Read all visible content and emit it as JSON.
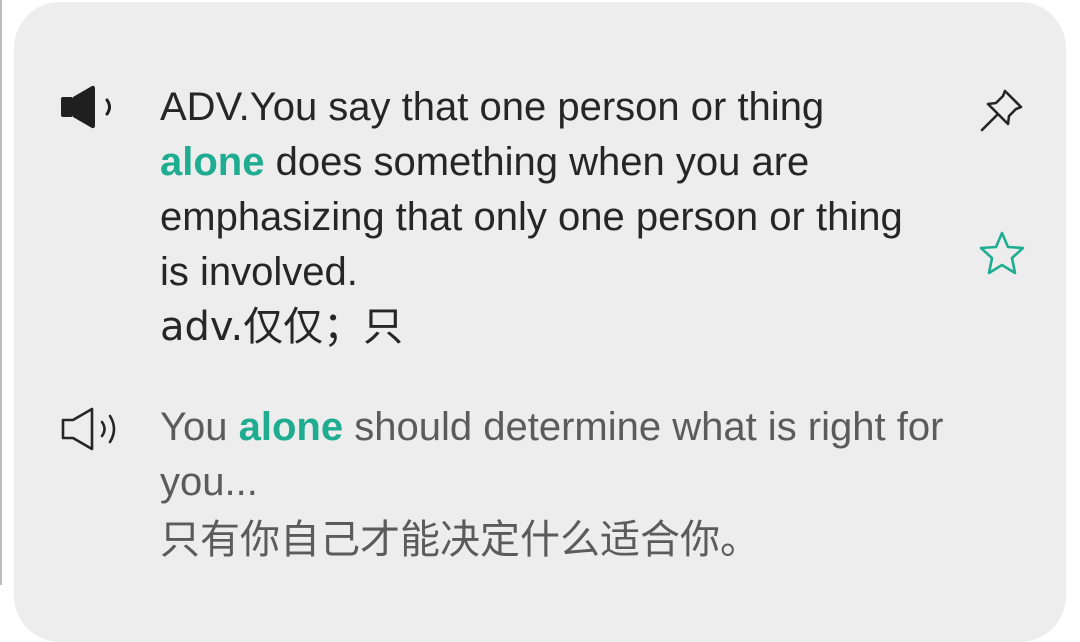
{
  "definition": {
    "text_before": "ADV.You say that one person or thing",
    "headword": "alone",
    "text_after": "does something when you are emphasizing that only one person or thing is involved.",
    "chinese": "adv.仅仅；只"
  },
  "example": {
    "text_before": "You",
    "headword": "alone",
    "text_after": "should determine what is right for you...",
    "chinese": "只有你自己才能决定什么适合你。"
  },
  "icons": {
    "definition_audio": "speaker-filled-icon",
    "example_audio": "speaker-outline-icon",
    "pin": "pin-icon",
    "favorite": "star-outline-icon"
  },
  "colors": {
    "accent": "#1fad91",
    "card_background": "#ededee",
    "primary_text": "#262626",
    "secondary_text": "#5b5b5b"
  }
}
